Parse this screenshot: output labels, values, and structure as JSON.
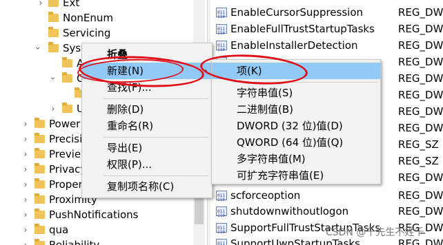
{
  "tree": {
    "items": [
      {
        "label": "Ext",
        "expanded": false
      },
      {
        "label": "NonEnum",
        "expanded": false
      },
      {
        "label": "Servicing",
        "expanded": false
      },
      {
        "label": "Syste",
        "expanded": true
      },
      {
        "label": "A",
        "expanded": false
      },
      {
        "label": "C",
        "expanded": true
      },
      {
        "label": "",
        "expanded": false
      },
      {
        "label": "U",
        "expanded": false
      },
      {
        "label": "Power",
        "expanded": false
      },
      {
        "label": "Precisi",
        "expanded": false
      },
      {
        "label": "Preview",
        "expanded": false
      },
      {
        "label": "Privacy",
        "expanded": false
      },
      {
        "label": "Proper",
        "expanded": false
      },
      {
        "label": "Proximity",
        "expanded": false
      },
      {
        "label": "PushNotifications",
        "expanded": false
      },
      {
        "label": "qua",
        "expanded": false
      },
      {
        "label": "Reliability",
        "expanded": false
      }
    ]
  },
  "values": {
    "rows": [
      {
        "name": "EnableCursorSuppression",
        "type": "REG_DWC"
      },
      {
        "name": "EnableFullTrustStartupTasks",
        "type": "REG_DWC"
      },
      {
        "name": "EnableInstallerDetection",
        "type": "REG_DWC"
      },
      {
        "name": "",
        "type": "REG_DWC"
      },
      {
        "name": "",
        "type": "REG_DWC"
      },
      {
        "name": "",
        "type": "REG_DWC"
      },
      {
        "name": "",
        "type": "REG_DWC"
      },
      {
        "name": "",
        "type": "REG_DWC"
      },
      {
        "name": "",
        "type": "REG_SZ"
      },
      {
        "name": "",
        "type": "REG_SZ"
      },
      {
        "name": "",
        "type": "REG_DWC"
      },
      {
        "name": "scforceoption",
        "type": "REG_DWC"
      },
      {
        "name": "shutdownwithoutlogon",
        "type": "REG_DWC"
      },
      {
        "name": "SupportFullTrustStartupTasks",
        "type": "REG_DWC"
      },
      {
        "name": "SupportUwpStartupTasks",
        "type": "REG_DWC"
      }
    ]
  },
  "context_menu": {
    "collapse": "折叠",
    "new": "新建(N)",
    "find": "查找(F)...",
    "delete": "删除(D)",
    "rename": "重命名(R)",
    "export": "导出(E)",
    "permissions": "权限(P)...",
    "copy_key_name": "复制项名称(C)",
    "submenu_arrow": "›"
  },
  "sub_menu": {
    "key": "项(K)",
    "string_value": "字符串值(S)",
    "binary_value": "二进制值(B)",
    "dword_value": "DWORD (32 位)值(D)",
    "qword_value": "QWORD (64 位)值(Q)",
    "multi_string_value": "多字符串值(M)",
    "expandable_string_value": "可扩充字符串值(E)"
  },
  "annotation_color": "#e0101a",
  "highlight_color": "#91c9f7",
  "watermark": "CSDN @千先生不姓千"
}
